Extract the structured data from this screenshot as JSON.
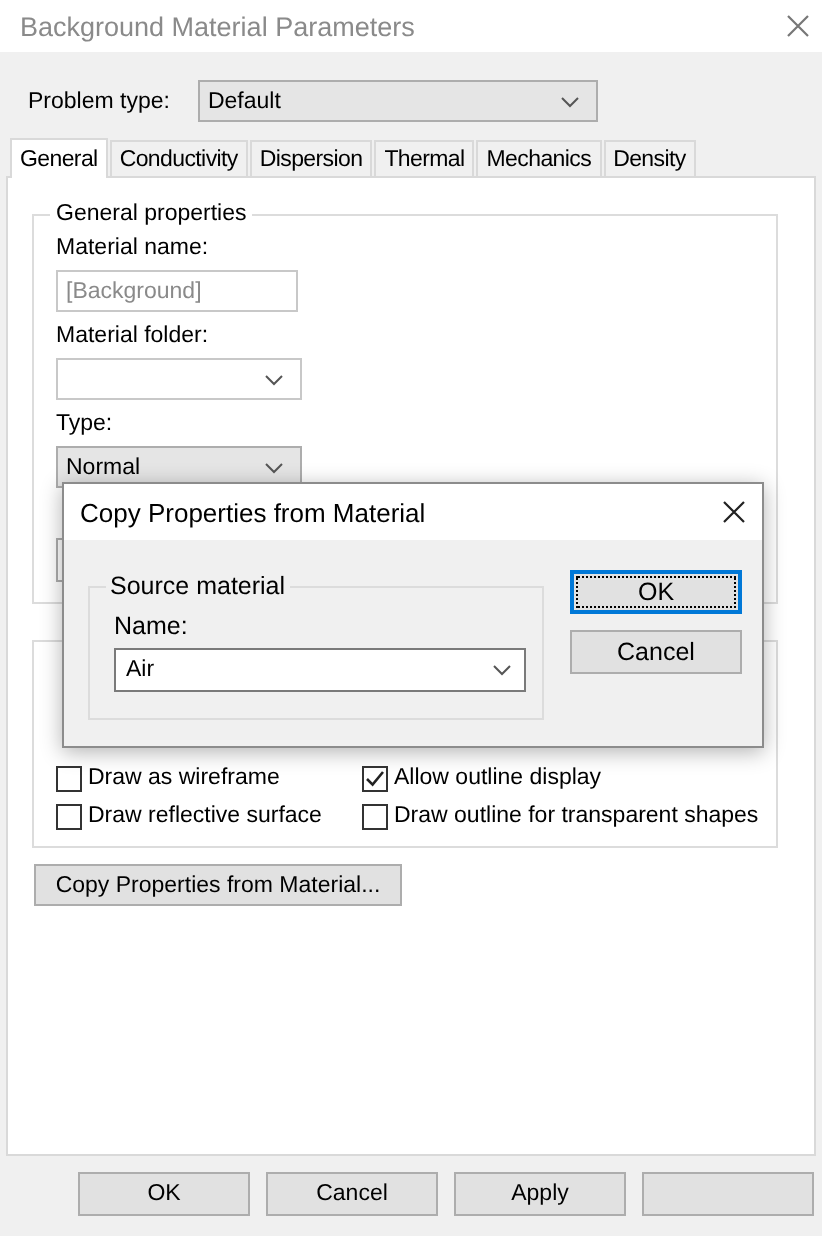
{
  "window": {
    "title": "Background Material Parameters"
  },
  "problem_type": {
    "label": "Problem type:",
    "value": "Default"
  },
  "tabs": [
    {
      "label": "General",
      "selected": true
    },
    {
      "label": "Conductivity",
      "selected": false
    },
    {
      "label": "Dispersion",
      "selected": false
    },
    {
      "label": "Thermal",
      "selected": false
    },
    {
      "label": "Mechanics",
      "selected": false
    },
    {
      "label": "Density",
      "selected": false
    }
  ],
  "general_group": {
    "title": "General properties",
    "material_name_label": "Material name:",
    "material_name_value": "[Background]",
    "material_folder_label": "Material folder:",
    "type_label": "Type:",
    "type_value": "Normal"
  },
  "display_group": {
    "checkboxes": [
      {
        "label": "Draw as wireframe",
        "checked": false
      },
      {
        "label": "Allow outline display",
        "checked": true
      },
      {
        "label": "Draw reflective surface",
        "checked": false
      },
      {
        "label": "Draw outline for transparent shapes",
        "checked": false
      }
    ]
  },
  "copy_button": "Copy Properties from Material...",
  "buttons": [
    {
      "kind": "text",
      "label": "OK"
    },
    {
      "kind": "text",
      "label": "Cancel"
    },
    {
      "kind": "text",
      "label": "Apply"
    },
    {
      "kind": "blank"
    }
  ],
  "dialog": {
    "title": "Copy Properties from Material",
    "group_title": "Source material",
    "name_label": "Name:",
    "name_value": "Air",
    "buttons": [
      {
        "label": "OK",
        "default": true
      },
      {
        "label": "Cancel",
        "default": false
      }
    ]
  }
}
